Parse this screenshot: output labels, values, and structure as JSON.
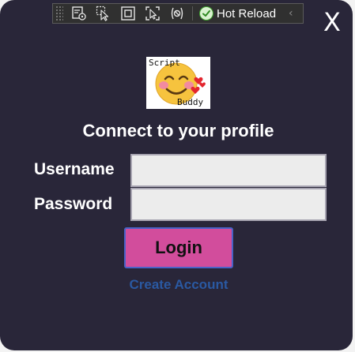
{
  "debug_toolbar": {
    "hot_reload_label": "Hot Reload",
    "icons": [
      "select-element-icon",
      "pointer-icon",
      "display-layout-icon",
      "track-focus-icon",
      "binding-failures-icon",
      "hot-reload-check-icon",
      "collapse-chevron-icon"
    ],
    "collapse_glyph": "‹"
  },
  "window": {
    "close_label": "X",
    "background": "#292639"
  },
  "logo": {
    "line1": "Script",
    "line2": "Buddy",
    "icon": "smiling-face-with-hearts-icon"
  },
  "title": "Connect to your profile",
  "form": {
    "username_label": "Username",
    "username_value": "",
    "password_label": "Password",
    "password_value": "",
    "login_label": "Login",
    "create_account_label": "Create Account"
  },
  "colors": {
    "accent_button": "#d24d9c",
    "link": "#2a59a2",
    "field_bg": "#ececec"
  }
}
